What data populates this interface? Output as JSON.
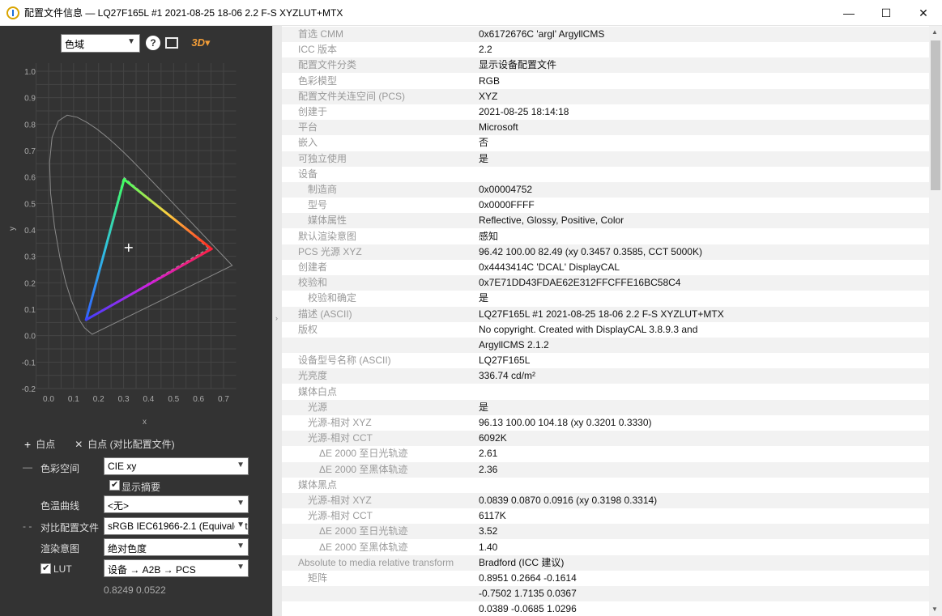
{
  "window": {
    "title": "配置文件信息 — LQ27F165L #1 2021-08-25 18-06 2.2 F-S XYZLUT+MTX",
    "minimize_glyph": "—",
    "maximize_glyph": "☐",
    "close_glyph": "✕"
  },
  "toolbar": {
    "view_select": "色域",
    "help_glyph": "?",
    "threed_label": "3D▾"
  },
  "plot": {
    "y_ticks": [
      "1.0",
      "0.9",
      "0.8",
      "0.7",
      "0.6",
      "0.5",
      "0.4",
      "0.3",
      "0.2",
      "0.1",
      "0.0",
      "-0.1",
      "-0.2"
    ],
    "x_ticks": [
      "0.0",
      "0.1",
      "0.2",
      "0.3",
      "0.4",
      "0.5",
      "0.6",
      "0.7"
    ],
    "x_label": "x",
    "y_label": "y",
    "gamut": {
      "red": [
        0.652,
        0.328
      ],
      "green": [
        0.302,
        0.591
      ],
      "blue": [
        0.15,
        0.06
      ]
    },
    "reference_gamut": {
      "red": [
        0.64,
        0.33
      ],
      "green": [
        0.3,
        0.6
      ],
      "blue": [
        0.15,
        0.06
      ]
    },
    "whitepoint": [
      0.3201,
      0.333
    ]
  },
  "legend": {
    "whitepoint_label": "白点",
    "compare_whitepoint_label": "白点 (对比配置文件)"
  },
  "controls": {
    "colorspace_label": "色彩空间",
    "colorspace_value": "CIE xy",
    "show_summary_label": "显示摘要",
    "tone_curve_label": "色温曲线",
    "tone_curve_value": "<无>",
    "compare_profile_label": "对比配置文件",
    "compare_profile_value": "sRGB IEC61966-2.1 (Equivalent",
    "intent_label": "渲染意图",
    "intent_value": "绝对色度",
    "lut_label": "LUT",
    "lut_value": "设备 → A2B → PCS",
    "coord_readout": "0.8249 0.0522"
  },
  "table": [
    {
      "key": "首选 CMM",
      "value": "0x6172676C 'argl' ArgyllCMS",
      "indent": 0
    },
    {
      "key": "ICC 版本",
      "value": "2.2",
      "indent": 0
    },
    {
      "key": "配置文件分类",
      "value": "显示设备配置文件",
      "indent": 0
    },
    {
      "key": "色彩模型",
      "value": "RGB",
      "indent": 0
    },
    {
      "key": "配置文件关连空间 (PCS)",
      "value": "XYZ",
      "indent": 0
    },
    {
      "key": "创建于",
      "value": "2021-08-25 18:14:18",
      "indent": 0
    },
    {
      "key": "平台",
      "value": "Microsoft",
      "indent": 0
    },
    {
      "key": "嵌入",
      "value": "否",
      "indent": 0
    },
    {
      "key": "可独立使用",
      "value": "是",
      "indent": 0
    },
    {
      "key": "设备",
      "value": "",
      "indent": 0
    },
    {
      "key": "制造商",
      "value": "0x00004752",
      "indent": 1
    },
    {
      "key": "型号",
      "value": "0x0000FFFF",
      "indent": 1
    },
    {
      "key": "媒体属性",
      "value": "Reflective, Glossy, Positive, Color",
      "indent": 1
    },
    {
      "key": "默认渲染意图",
      "value": "感知",
      "indent": 0
    },
    {
      "key": "PCS 光源 XYZ",
      "value": "96.42 100.00  82.49 (xy 0.3457 0.3585, CCT 5000K)",
      "indent": 0
    },
    {
      "key": "创建者",
      "value": "0x4443414C 'DCAL' DisplayCAL",
      "indent": 0
    },
    {
      "key": "校验和",
      "value": "0x7E71DD43FDAE62E312FFCFFE16BC58C4",
      "indent": 0
    },
    {
      "key": "校验和确定",
      "value": "是",
      "indent": 1
    },
    {
      "key": "描述 (ASCII)",
      "value": "LQ27F165L #1 2021-08-25 18-06 2.2 F-S XYZLUT+MTX",
      "indent": 0
    },
    {
      "key": "版权",
      "value": "No copyright. Created with DisplayCAL 3.8.9.3 and",
      "indent": 0
    },
    {
      "key": "",
      "value": "ArgyllCMS 2.1.2",
      "indent": 0
    },
    {
      "key": "设备型号名称 (ASCII)",
      "value": "LQ27F165L",
      "indent": 0
    },
    {
      "key": "光亮度",
      "value": "336.74 cd/m²",
      "indent": 0
    },
    {
      "key": "媒体白点",
      "value": "",
      "indent": 0
    },
    {
      "key": "光源",
      "value": "是",
      "indent": 1
    },
    {
      "key": "光源-相对 XYZ",
      "value": "96.13 100.00 104.18 (xy 0.3201 0.3330)",
      "indent": 1
    },
    {
      "key": "光源-相对 CCT",
      "value": "6092K",
      "indent": 1
    },
    {
      "key": "ΔE 2000 至日光轨迹",
      "value": "2.61",
      "indent": 2
    },
    {
      "key": "ΔE 2000 至黑体轨迹",
      "value": "2.36",
      "indent": 2
    },
    {
      "key": "媒体黑点",
      "value": "",
      "indent": 0
    },
    {
      "key": "光源-相对 XYZ",
      "value": "0.0839 0.0870 0.0916 (xy 0.3198 0.3314)",
      "indent": 1
    },
    {
      "key": "光源-相对 CCT",
      "value": "6117K",
      "indent": 1
    },
    {
      "key": "ΔE 2000 至日光轨迹",
      "value": "3.52",
      "indent": 2
    },
    {
      "key": "ΔE 2000 至黑体轨迹",
      "value": "1.40",
      "indent": 2
    },
    {
      "key": "Absolute to media relative transform",
      "value": "Bradford (ICC 建议)",
      "indent": 0
    },
    {
      "key": "矩阵",
      "value": "0.8951 0.2664 -0.1614",
      "indent": 1
    },
    {
      "key": "",
      "value": "-0.7502 1.7135 0.0367",
      "indent": 0
    },
    {
      "key": "",
      "value": "0.0389 -0.0685 1.0296",
      "indent": 0
    }
  ]
}
